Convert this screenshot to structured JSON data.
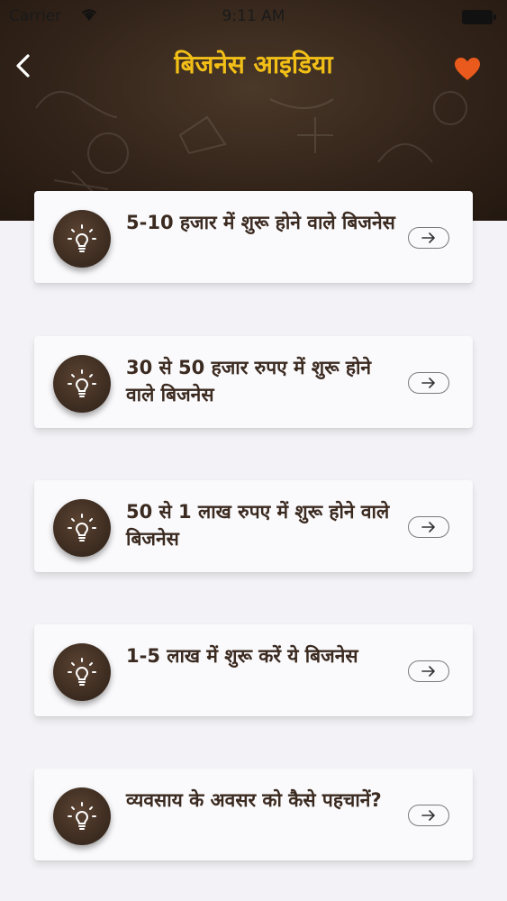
{
  "status_bar": {
    "carrier": "Carrier",
    "time": "9:11 AM"
  },
  "header": {
    "title": "बिजनेस आइडिया",
    "title_color": "#f2bf17",
    "heart_color": "#ea5a1c",
    "background_color": "#33241a"
  },
  "cards": [
    {
      "label": "5-10 हजार में शुरू होने वाले बिजनेस",
      "icon": "lightbulb-icon"
    },
    {
      "label": "30 से 50 हजार रुपए में शुरू होने वाले बिजनेस",
      "icon": "lightbulb-icon"
    },
    {
      "label": "50 से 1 लाख रुपए में शुरू होने वाले बिजनेस",
      "icon": "lightbulb-icon"
    },
    {
      "label": "1-5 लाख में शुरू करें ये बिजनेस",
      "icon": "lightbulb-icon"
    },
    {
      "label": "व्यवसाय के अवसर को कैसे पहचानें?",
      "icon": "lightbulb-icon"
    }
  ]
}
